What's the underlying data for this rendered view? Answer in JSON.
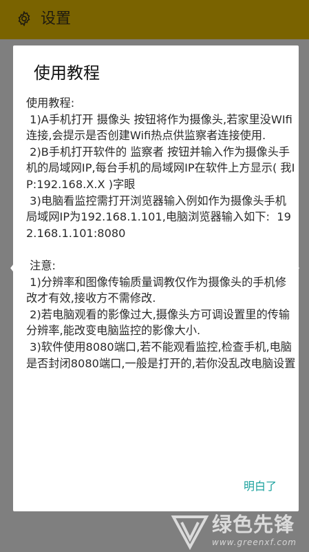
{
  "appbar": {
    "title": "设置",
    "icon": "gear-icon",
    "color": "#7a6300"
  },
  "dialog": {
    "title": "使用教程",
    "body": "使用教程:\n 1)A手机打开 摄像头 按钮将作为摄像头,若家里没WIfi连接,会提示是否创建Wifi热点供监察者连接使用.\n 2)B手机打开软件的 监察者 按钮并输入作为摄像头手机的局域网IP,每台手机的局域网IP在软件上方显示( 我IP:192.168.X.X )字眼\n 3)电脑看监控需打开浏览器输入例如作为摄像头手机局域网IP为192.168.1.101,电脑浏览器输入如下:  192.168.1.101:8080\n\n 注意:\n 1)分辨率和图像传输质量调教仅作为摄像头的手机修改才有效,接收方不需修改.\n 2)若电脑观看的影像过大,摄像头方可调设置里的传输分辨率,能改变电脑监控的影像大小.\n 3)软件使用8080端口,若不能观看监控,检查手机,电脑是否封闭8080端口,一般是打开的,若你没乱改电脑设置",
    "ok_label": "明白了",
    "accent": "#1aa19d"
  },
  "navigation": {
    "left_icon": "chevron-left-icon",
    "right_icon": "chevron-right-icon"
  },
  "watermark": {
    "brand": "绿色先锋",
    "url": "www.greenxf.com"
  }
}
